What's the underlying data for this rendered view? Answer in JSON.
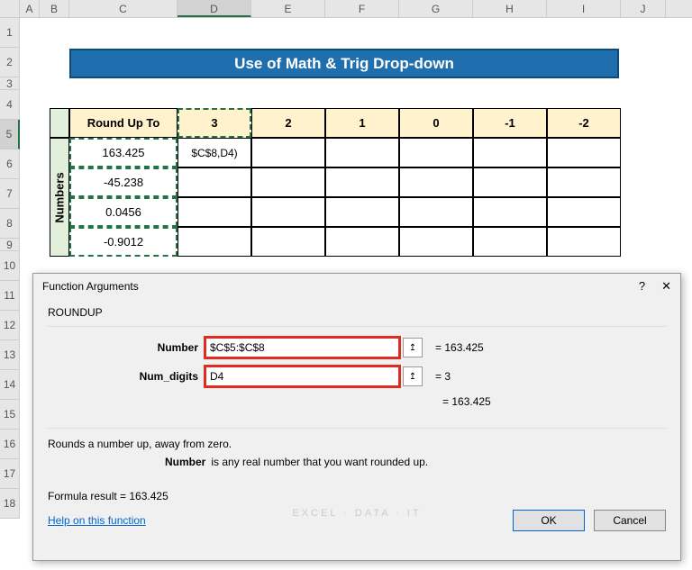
{
  "columns": [
    "A",
    "B",
    "C",
    "D",
    "E",
    "F",
    "G",
    "H",
    "I",
    "J"
  ],
  "rows": [
    "1",
    "2",
    "3",
    "4",
    "5",
    "6",
    "7",
    "8",
    "9",
    "10",
    "11",
    "12",
    "13",
    "14",
    "15",
    "16",
    "17",
    "18"
  ],
  "selected_col": "D",
  "selected_row": "5",
  "title": "Use of Math & Trig Drop-down",
  "table": {
    "side_label": "Numbers",
    "roundup_label": "Round Up To",
    "headers": [
      "3",
      "2",
      "1",
      "0",
      "-1",
      "-2"
    ],
    "numbers": [
      "163.425",
      "-45.238",
      "0.0456",
      "-0.9012"
    ],
    "formula_preview": "$C$8,D4)"
  },
  "dialog": {
    "title": "Function Arguments",
    "func": "ROUNDUP",
    "number_label": "Number",
    "number_value": "$C$5:$C$8",
    "number_result": "=  163.425",
    "digits_label": "Num_digits",
    "digits_value": "D4",
    "digits_result": "=  3",
    "eval_result": "=  163.425",
    "desc": "Rounds a number up, away from zero.",
    "detail_label": "Number",
    "detail_text": "is any real number that you want rounded up.",
    "formula_result_label": "Formula result =  ",
    "formula_result_value": "163.425",
    "help": "Help on this function",
    "ok": "OK",
    "cancel": "Cancel"
  },
  "watermark": "EXCEL · DATA · IT",
  "chart_data": {
    "type": "table",
    "title": "Use of Math & Trig Drop-down",
    "row_label": "Numbers",
    "col_label": "Round Up To",
    "columns": [
      3,
      2,
      1,
      0,
      -1,
      -2
    ],
    "rows": [
      163.425,
      -45.238,
      0.0456,
      -0.9012
    ],
    "formula": "ROUNDUP($C$5:$C$8, D4)",
    "first_result": 163.425
  }
}
